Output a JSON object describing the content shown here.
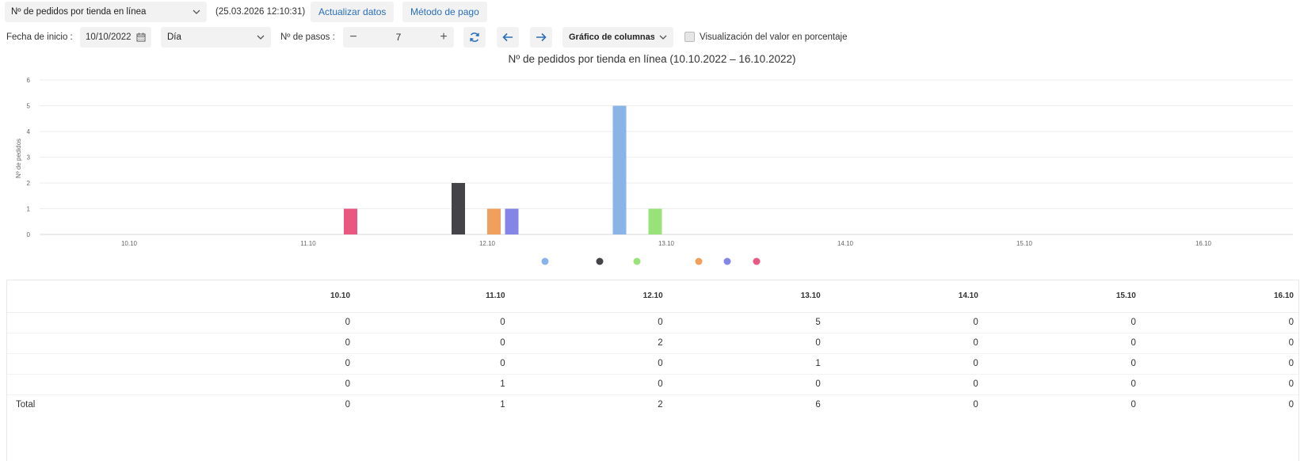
{
  "toolbar": {
    "report_select": "Nº de pedidos por tienda en línea",
    "timestamp": "(25.03.2026 12:10:31)",
    "refresh_label": "Actualizar datos",
    "payment_label": "Método de pago"
  },
  "controls": {
    "start_date_label": "Fecha de inicio :",
    "start_date_value": "10/10/2022",
    "period_value": "Día",
    "steps_label": "Nº de pasos :",
    "steps_value": "7",
    "chart_type_value": "Gráfico de columnas",
    "percent_label": "Visualización del valor en porcentaje"
  },
  "chart_data": {
    "type": "bar",
    "title": "Nº de pedidos por tienda en línea (10.10.2022 – 16.10.2022)",
    "ylabel": "Nº de pedidos",
    "ylim": [
      0,
      6
    ],
    "yticks": [
      "0",
      "1",
      "2",
      "3",
      "4",
      "5",
      "6"
    ],
    "grid": true,
    "categories": [
      "10.10",
      "11.10",
      "12.10",
      "13.10",
      "14.10",
      "15.10",
      "16.10"
    ],
    "series": [
      {
        "color": "#8ab4e8",
        "values": [
          0,
          0,
          0,
          5,
          0,
          0,
          0
        ]
      },
      {
        "color": "#444448",
        "values": [
          0,
          0,
          2,
          0,
          0,
          0,
          0
        ]
      },
      {
        "color": "#99e27a",
        "values": [
          0,
          0,
          0,
          1,
          0,
          0,
          0
        ]
      },
      {
        "color": "#f0a05c",
        "values": [
          0,
          0,
          1,
          0,
          0,
          0,
          0
        ]
      },
      {
        "color": "#8585e8",
        "values": [
          0,
          0,
          1,
          0,
          0,
          0,
          0
        ]
      },
      {
        "color": "#e85880",
        "values": [
          0,
          1,
          0,
          0,
          0,
          0,
          0
        ]
      }
    ]
  },
  "table": {
    "headers": [
      "10.10",
      "11.10",
      "12.10",
      "13.10",
      "14.10",
      "15.10",
      "16.10"
    ],
    "rows": [
      {
        "label": "",
        "values": [
          "0",
          "0",
          "0",
          "5",
          "0",
          "0",
          "0"
        ]
      },
      {
        "label": "",
        "values": [
          "0",
          "0",
          "2",
          "0",
          "0",
          "0",
          "0"
        ]
      },
      {
        "label": "",
        "values": [
          "0",
          "0",
          "0",
          "1",
          "0",
          "0",
          "0"
        ]
      },
      {
        "label": "",
        "values": [
          "0",
          "1",
          "0",
          "0",
          "0",
          "0",
          "0"
        ]
      }
    ],
    "total": {
      "label": "Total",
      "values": [
        "0",
        "1",
        "2",
        "6",
        "0",
        "0",
        "0"
      ]
    }
  }
}
